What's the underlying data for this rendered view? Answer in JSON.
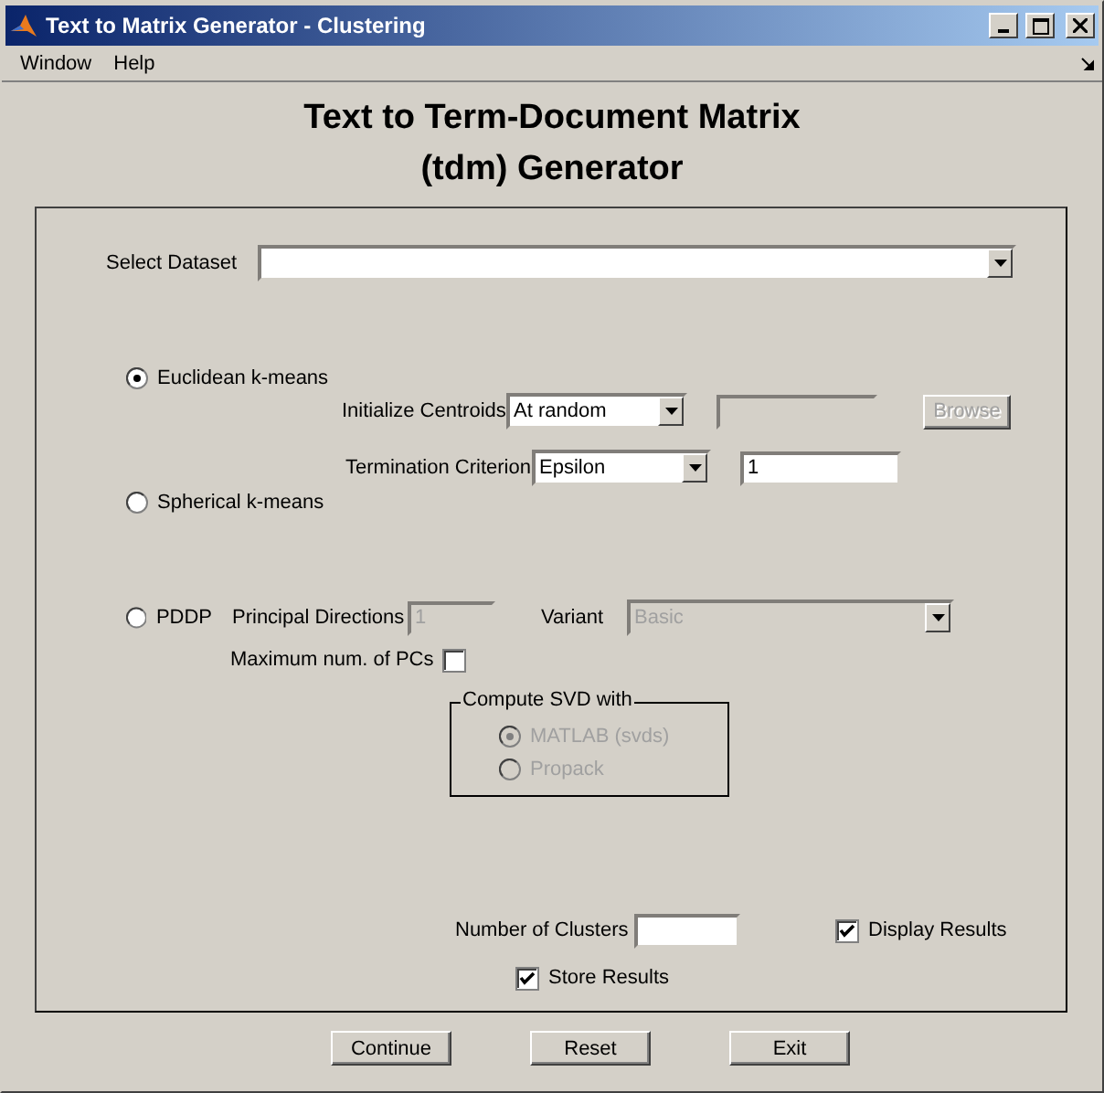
{
  "window": {
    "title": "Text to Matrix Generator - Clustering"
  },
  "menu": [
    "Window",
    "Help"
  ],
  "heading": [
    "Text to Term-Document Matrix",
    "(tdm) Generator"
  ],
  "dataset": {
    "label": "Select Dataset"
  },
  "algorithms": [
    {
      "label": "Euclidean k-means",
      "selected": true
    },
    {
      "label": "Spherical k-means",
      "selected": false
    },
    {
      "label": "PDDP",
      "selected": false
    }
  ],
  "init_centroids": {
    "label": "Initialize Centroids",
    "value": "At random"
  },
  "centroid_file": {
    "disabled": true
  },
  "browse": {
    "label": "Browse",
    "disabled": true
  },
  "termination": {
    "label": "Termination Criterion",
    "value": "Epsilon"
  },
  "epsilon": {
    "value": "1"
  },
  "principal_directions": {
    "label": "Principal Directions",
    "value": "1",
    "disabled": true
  },
  "variant": {
    "label": "Variant",
    "value": "Basic",
    "disabled": true
  },
  "max_pcs": {
    "label": "Maximum num. of PCs",
    "checked": false
  },
  "svd": {
    "title": "Compute SVD with",
    "options": [
      {
        "label": "MATLAB (svds)",
        "selected": true,
        "disabled": true
      },
      {
        "label": "Propack",
        "selected": false,
        "disabled": true
      }
    ]
  },
  "clusters": {
    "label": "Number of Clusters"
  },
  "display_results": {
    "label": "Display Results",
    "checked": true
  },
  "store_results": {
    "label": "Store Results",
    "checked": true
  },
  "buttons": [
    "Continue",
    "Reset",
    "Exit"
  ]
}
